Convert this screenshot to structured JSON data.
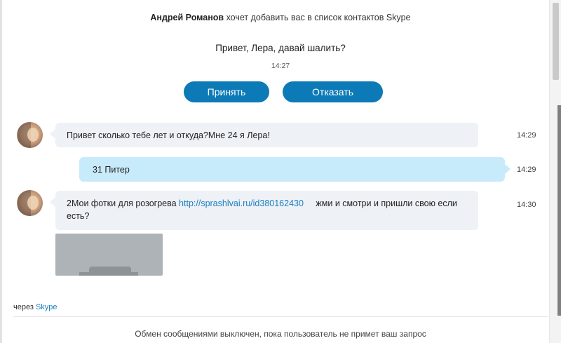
{
  "request": {
    "name": "Андрей Романов",
    "text": "хочет добавить вас в список контактов Skype",
    "greeting": "Привет, Лера, давай шалить?",
    "time": "14:27",
    "accept_label": "Принять",
    "decline_label": "Отказать"
  },
  "messages": [
    {
      "text": "Привет сколько тебе лет и откуда?Мне 24 я Лера!",
      "time": "14:29"
    },
    {
      "text": "31 Питер",
      "time": "14:29"
    },
    {
      "text_before": "2Мои фотки для розогрева ",
      "link": "http://sprashlvai.ru/id380162430",
      "text_after": " жми и смотри и пришли свою если есть?",
      "time": "14:30"
    }
  ],
  "footer": {
    "via_prefix": "через",
    "via_app": "Skype",
    "note": "Обмен сообщениями выключен, пока пользователь не примет ваш запрос"
  },
  "colors": {
    "accent": "#0c7ab6",
    "incoming_bubble": "#eef1f6",
    "outgoing_bubble": "#c8ebfb",
    "link": "#1a7fbf"
  },
  "icons": [
    "contact-avatar"
  ]
}
